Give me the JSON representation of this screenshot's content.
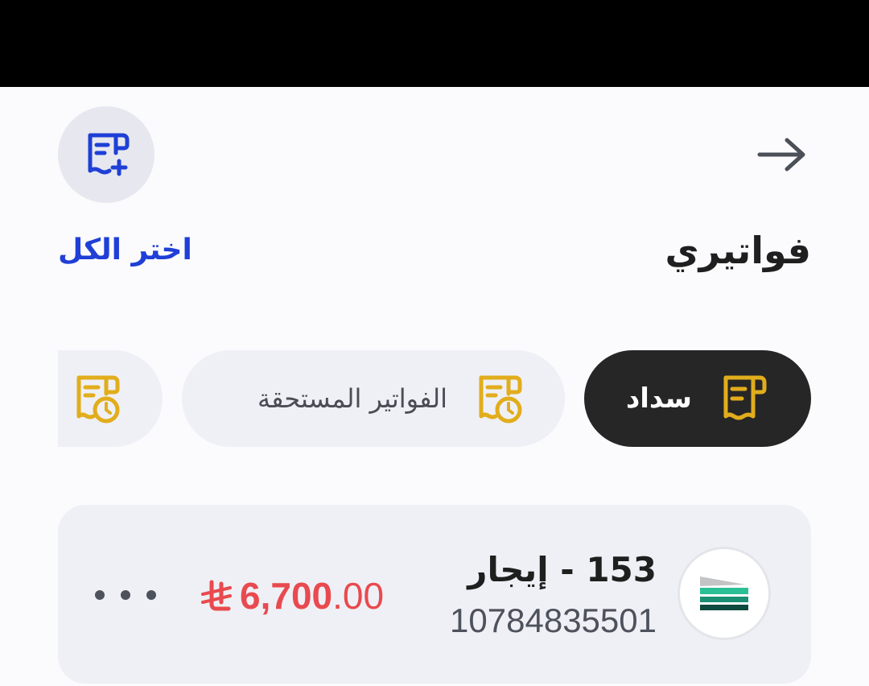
{
  "header": {
    "title": "فواتيري",
    "select_all_label": "اختر الكل",
    "back_icon": "arrow-right-icon",
    "add_icon": "receipt-add-icon"
  },
  "tabs": [
    {
      "label": "سداد",
      "icon": "receipt-icon",
      "active": true
    },
    {
      "label": "الفواتير المستحقة",
      "icon": "receipt-clock-icon",
      "active": false
    },
    {
      "label": "",
      "icon": "receipt-clock-icon",
      "active": false
    }
  ],
  "bills": [
    {
      "title": "153 - إيجار",
      "number": "10784835501",
      "amount_int": "6,700",
      "amount_dec": ".00",
      "currency_icon": "saudi-riyal-icon",
      "logo": "biller-logo-icon",
      "more_icon": "more-icon"
    }
  ],
  "colors": {
    "accent": "#1f3fd6",
    "chip_icon": "#e2ad1c",
    "amount": "#e84a4f",
    "active_chip": "#262626"
  }
}
